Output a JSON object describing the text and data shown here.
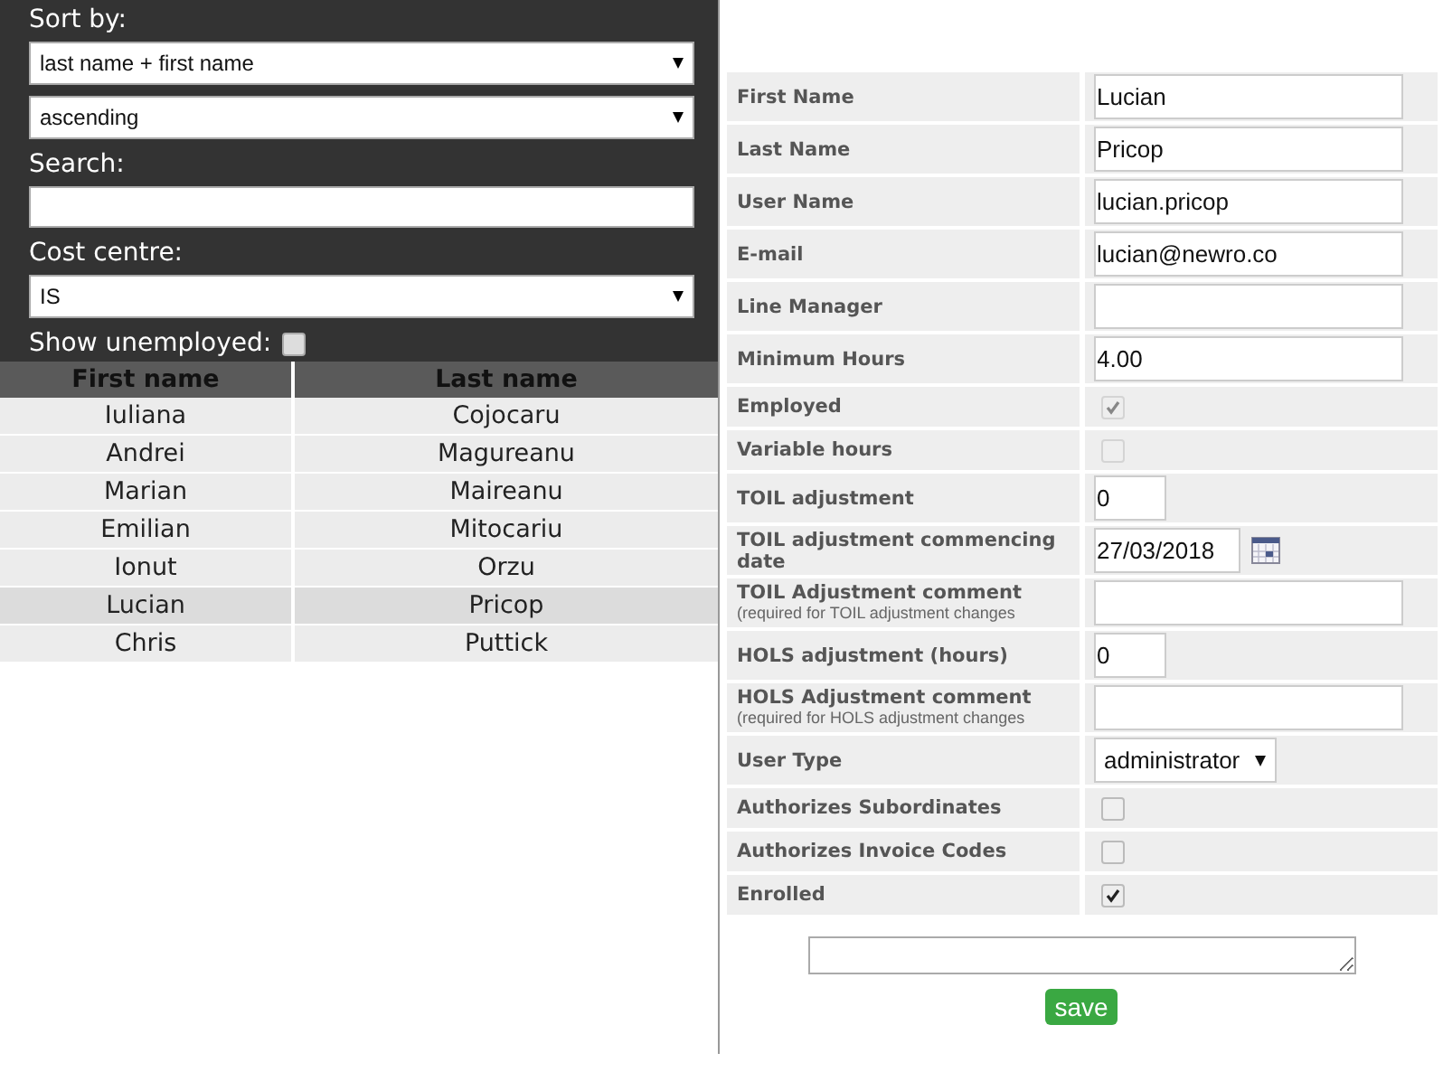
{
  "filters": {
    "sort_label": "Sort by:",
    "sort_field": "last name + first name",
    "sort_order": "ascending",
    "search_label": "Search:",
    "cost_centre_label": "Cost centre:",
    "cost_centre": "IS",
    "show_unemployed_label": "Show unemployed:",
    "show_unemployed": false
  },
  "table": {
    "columns": [
      "First name",
      "Last name"
    ],
    "rows": [
      {
        "first": "Iuliana",
        "last": "Cojocaru",
        "selected": false
      },
      {
        "first": "Andrei",
        "last": "Magureanu",
        "selected": false
      },
      {
        "first": "Marian",
        "last": "Maireanu",
        "selected": false
      },
      {
        "first": "Emilian",
        "last": "Mitocariu",
        "selected": false
      },
      {
        "first": "Ionut",
        "last": "Orzu",
        "selected": false
      },
      {
        "first": "Lucian",
        "last": "Pricop",
        "selected": true
      },
      {
        "first": "Chris",
        "last": "Puttick",
        "selected": false
      }
    ]
  },
  "form": {
    "fields": [
      {
        "label": "First Name",
        "kind": "text",
        "value": "Lucian"
      },
      {
        "label": "Last Name",
        "kind": "text",
        "value": "Pricop"
      },
      {
        "label": "User Name",
        "kind": "text",
        "value": "lucian.pricop"
      },
      {
        "label": "E-mail",
        "kind": "text",
        "value": "lucian@newro.co"
      },
      {
        "label": "Line Manager",
        "kind": "text"
      },
      {
        "label": "Minimum Hours",
        "kind": "text",
        "value": "4.00"
      },
      {
        "label": "Employed",
        "kind": "checkbox",
        "checked": true,
        "disabled": true
      },
      {
        "label": "Variable hours",
        "kind": "checkbox",
        "checked": false,
        "disabled": true
      },
      {
        "label": "TOIL adjustment",
        "kind": "number",
        "value": "0"
      },
      {
        "label": "TOIL adjustment commencing date",
        "kind": "date",
        "value": "27/03/2018"
      },
      {
        "label": "TOIL Adjustment comment",
        "note": "(required for TOIL adjustment changes",
        "kind": "text"
      },
      {
        "label": "HOLS adjustment (hours)",
        "kind": "number",
        "value": "0"
      },
      {
        "label": "HOLS Adjustment comment",
        "note": "(required for HOLS adjustment changes",
        "kind": "text"
      },
      {
        "label": "User Type",
        "kind": "select",
        "value": "administrator"
      },
      {
        "label": "Authorizes Subordinates",
        "kind": "checkbox",
        "checked": false,
        "disabled": false
      },
      {
        "label": "Authorizes Invoice Codes",
        "kind": "checkbox",
        "checked": false,
        "disabled": false
      },
      {
        "label": "Enrolled",
        "kind": "checkbox",
        "checked": true,
        "disabled": false
      }
    ],
    "save_button": "save"
  }
}
